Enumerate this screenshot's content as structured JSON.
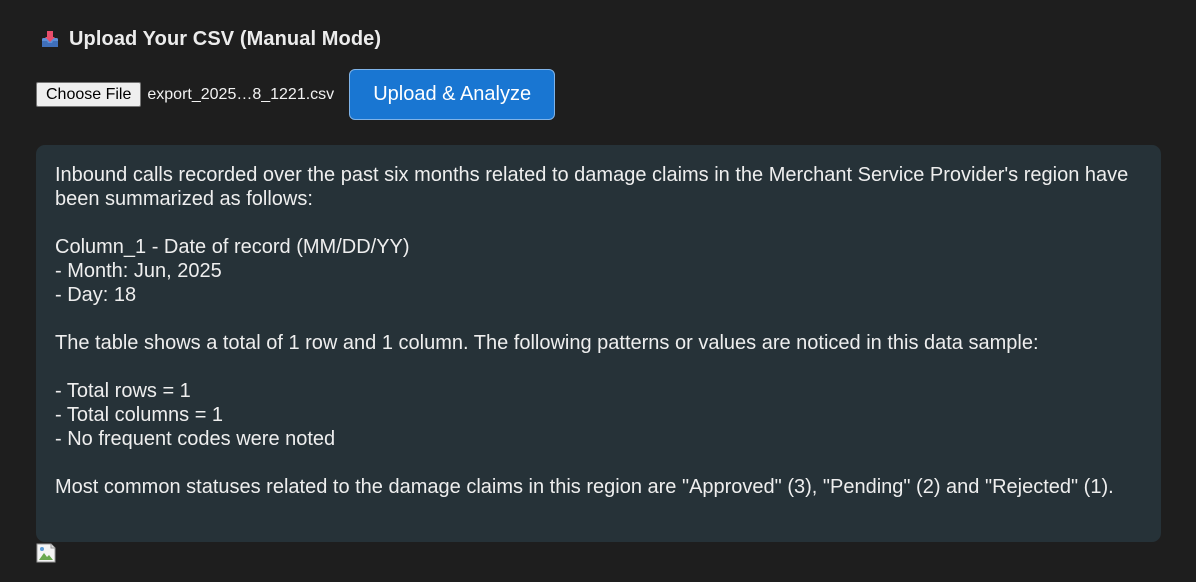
{
  "header": {
    "title": "Upload Your CSV (Manual Mode)",
    "icon": "inbox-tray-icon"
  },
  "upload": {
    "choose_file_label": "Choose File",
    "file_name": "export_2025…8_1221.csv",
    "submit_label": "Upload & Analyze"
  },
  "result": {
    "intro": "Inbound calls recorded over the past six months related to damage claims in the Merchant Service Provider's region have been summarized as follows:",
    "column_heading": "Column_1 - Date of record (MM/DD/YY)",
    "column_details": [
      "- Month: Jun, 2025",
      "- Day: 18"
    ],
    "table_summary": "The table shows a total of 1 row and 1 column. The following patterns or values are noticed in this data sample:",
    "stats": [
      "- Total rows = 1",
      "- Total columns = 1",
      "- No frequent codes were noted"
    ],
    "statuses": "Most common statuses related to the damage claims in this region are \"Approved\" (3), \"Pending\" (2) and \"Rejected\" (1)."
  },
  "colors": {
    "background": "#1e1e1e",
    "panel": "#263238",
    "accent": "#1976d2"
  },
  "chart_image": {
    "icon": "broken-image-icon"
  }
}
